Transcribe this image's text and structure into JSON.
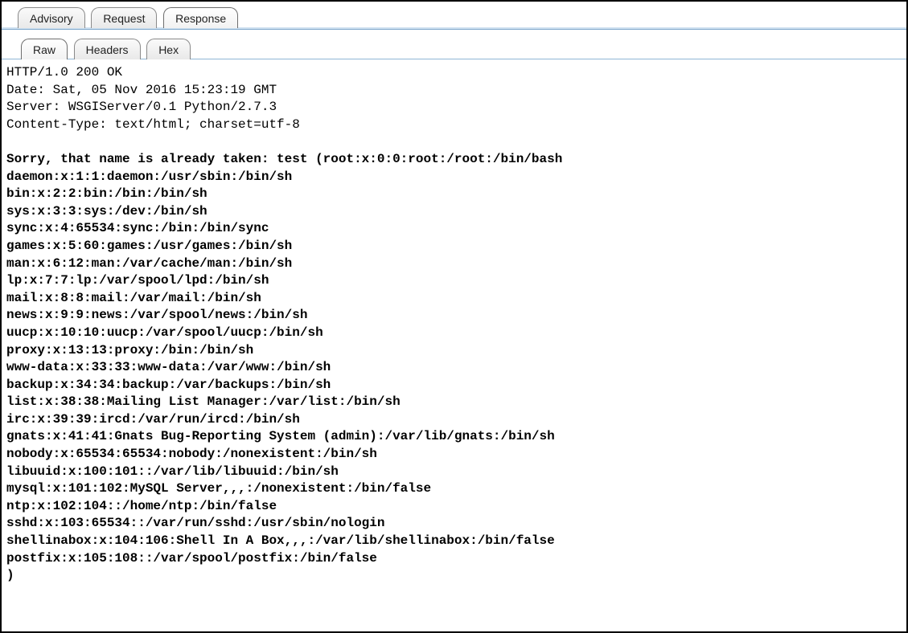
{
  "outer_tabs": {
    "advisory": "Advisory",
    "request": "Request",
    "response": "Response",
    "active": "response"
  },
  "inner_tabs": {
    "raw": "Raw",
    "headers": "Headers",
    "hex": "Hex",
    "active": "raw"
  },
  "response": {
    "status_line": "HTTP/1.0 200 OK",
    "headers": [
      "Date: Sat, 05 Nov 2016 15:23:19 GMT",
      "Server: WSGIServer/0.1 Python/2.7.3",
      "Content-Type: text/html; charset=utf-8"
    ],
    "body_lines": [
      "Sorry, that name is already taken: test (root:x:0:0:root:/root:/bin/bash",
      "daemon:x:1:1:daemon:/usr/sbin:/bin/sh",
      "bin:x:2:2:bin:/bin:/bin/sh",
      "sys:x:3:3:sys:/dev:/bin/sh",
      "sync:x:4:65534:sync:/bin:/bin/sync",
      "games:x:5:60:games:/usr/games:/bin/sh",
      "man:x:6:12:man:/var/cache/man:/bin/sh",
      "lp:x:7:7:lp:/var/spool/lpd:/bin/sh",
      "mail:x:8:8:mail:/var/mail:/bin/sh",
      "news:x:9:9:news:/var/spool/news:/bin/sh",
      "uucp:x:10:10:uucp:/var/spool/uucp:/bin/sh",
      "proxy:x:13:13:proxy:/bin:/bin/sh",
      "www-data:x:33:33:www-data:/var/www:/bin/sh",
      "backup:x:34:34:backup:/var/backups:/bin/sh",
      "list:x:38:38:Mailing List Manager:/var/list:/bin/sh",
      "irc:x:39:39:ircd:/var/run/ircd:/bin/sh",
      "gnats:x:41:41:Gnats Bug-Reporting System (admin):/var/lib/gnats:/bin/sh",
      "nobody:x:65534:65534:nobody:/nonexistent:/bin/sh",
      "libuuid:x:100:101::/var/lib/libuuid:/bin/sh",
      "mysql:x:101:102:MySQL Server,,,:/nonexistent:/bin/false",
      "ntp:x:102:104::/home/ntp:/bin/false",
      "sshd:x:103:65534::/var/run/sshd:/usr/sbin/nologin",
      "shellinabox:x:104:106:Shell In A Box,,,:/var/lib/shellinabox:/bin/false",
      "postfix:x:105:108::/var/spool/postfix:/bin/false",
      ")"
    ]
  }
}
